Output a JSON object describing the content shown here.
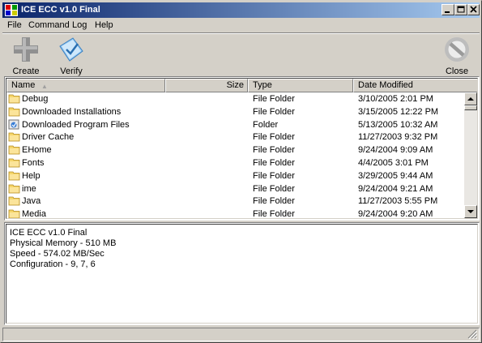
{
  "window": {
    "title": "ICE ECC v1.0 Final"
  },
  "titlebar_buttons": [
    "minimize",
    "maximize",
    "close"
  ],
  "menu": [
    "File",
    "Command",
    "Log",
    "Help"
  ],
  "toolbar": {
    "create_label": "Create",
    "verify_label": "Verify",
    "close_label": "Close"
  },
  "columns": {
    "name": "Name",
    "size": "Size",
    "type": "Type",
    "date": "Date Modified"
  },
  "rows": [
    {
      "name": "Debug",
      "size": "",
      "type": "File Folder",
      "date": "3/10/2005 2:01 PM",
      "icon": "folder-icon"
    },
    {
      "name": "Downloaded Installations",
      "size": "",
      "type": "File Folder",
      "date": "3/15/2005 12:22 PM",
      "icon": "folder-icon"
    },
    {
      "name": "Downloaded Program Files",
      "size": "",
      "type": "Folder",
      "date": "5/13/2005 10:32 AM",
      "icon": "special-folder-icon"
    },
    {
      "name": "Driver Cache",
      "size": "",
      "type": "File Folder",
      "date": "11/27/2003 9:32 PM",
      "icon": "folder-icon"
    },
    {
      "name": "EHome",
      "size": "",
      "type": "File Folder",
      "date": "9/24/2004 9:09 AM",
      "icon": "folder-icon"
    },
    {
      "name": "Fonts",
      "size": "",
      "type": "File Folder",
      "date": "4/4/2005 3:01 PM",
      "icon": "folder-icon"
    },
    {
      "name": "Help",
      "size": "",
      "type": "File Folder",
      "date": "3/29/2005 9:44 AM",
      "icon": "folder-icon"
    },
    {
      "name": "ime",
      "size": "",
      "type": "File Folder",
      "date": "9/24/2004 9:21 AM",
      "icon": "folder-icon"
    },
    {
      "name": "Java",
      "size": "",
      "type": "File Folder",
      "date": "11/27/2003 5:55 PM",
      "icon": "folder-icon"
    },
    {
      "name": "Media",
      "size": "",
      "type": "File Folder",
      "date": "9/24/2004 9:20 AM",
      "icon": "folder-icon"
    }
  ],
  "info": [
    "ICE ECC v1.0 Final",
    "Physical Memory - 510 MB",
    "Speed - 574.02 MB/Sec",
    "Configuration - 9, 7, 6"
  ],
  "colors": {
    "title_start": "#0a246a",
    "title_end": "#a6caf0",
    "folder": "#f6d66a",
    "chrome": "#d4d0c8"
  }
}
